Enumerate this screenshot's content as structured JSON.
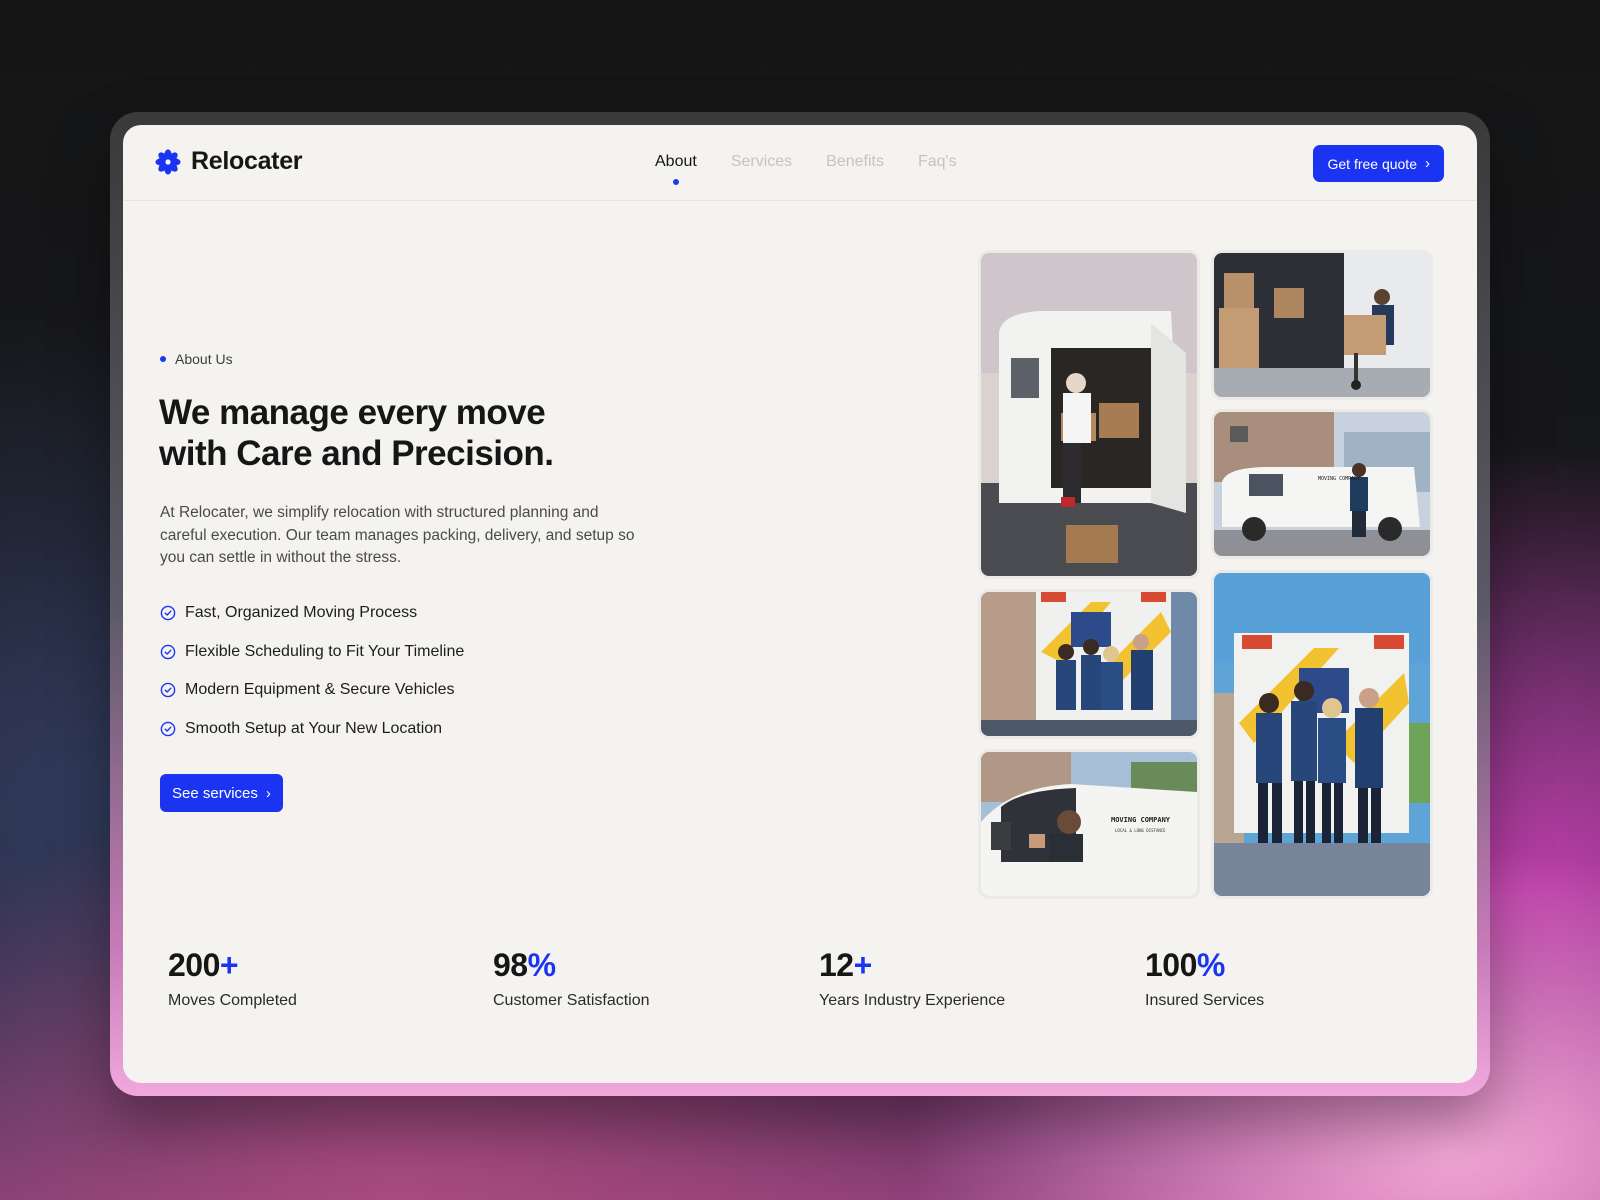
{
  "brand": {
    "name": "Relocater",
    "accent": "#1a34f2"
  },
  "nav": {
    "links": [
      {
        "label": "About",
        "active": true
      },
      {
        "label": "Services",
        "active": false
      },
      {
        "label": "Benefits",
        "active": false
      },
      {
        "label": "Faq's",
        "active": false
      }
    ],
    "cta_label": "Get free quote"
  },
  "hero": {
    "eyebrow": "About Us",
    "headline_line1": "We manage every move",
    "headline_line2": "with Care and Precision.",
    "intro": "At Relocater, we simplify relocation with structured planning and careful execution. Our team manages packing, delivery, and setup so you can settle in without the stress.",
    "features": [
      "Fast, Organized Moving Process",
      "Flexible Scheduling to Fit Your Timeline",
      "Modern Equipment & Secure Vehicles",
      "Smooth Setup at Your New Location"
    ],
    "cta_label": "See services"
  },
  "stats": [
    {
      "value": "200",
      "suffix": "+",
      "label": "Moves Completed"
    },
    {
      "value": "98",
      "suffix": "%",
      "label": "Customer Satisfaction"
    },
    {
      "value": "12",
      "suffix": "+",
      "label": "Years Industry Experience"
    },
    {
      "value": "100",
      "suffix": "%",
      "label": "Insured Services"
    }
  ],
  "gallery_van_text": [
    "MOVING COMPANY",
    "LOCAL & LONG DISTANCE"
  ]
}
